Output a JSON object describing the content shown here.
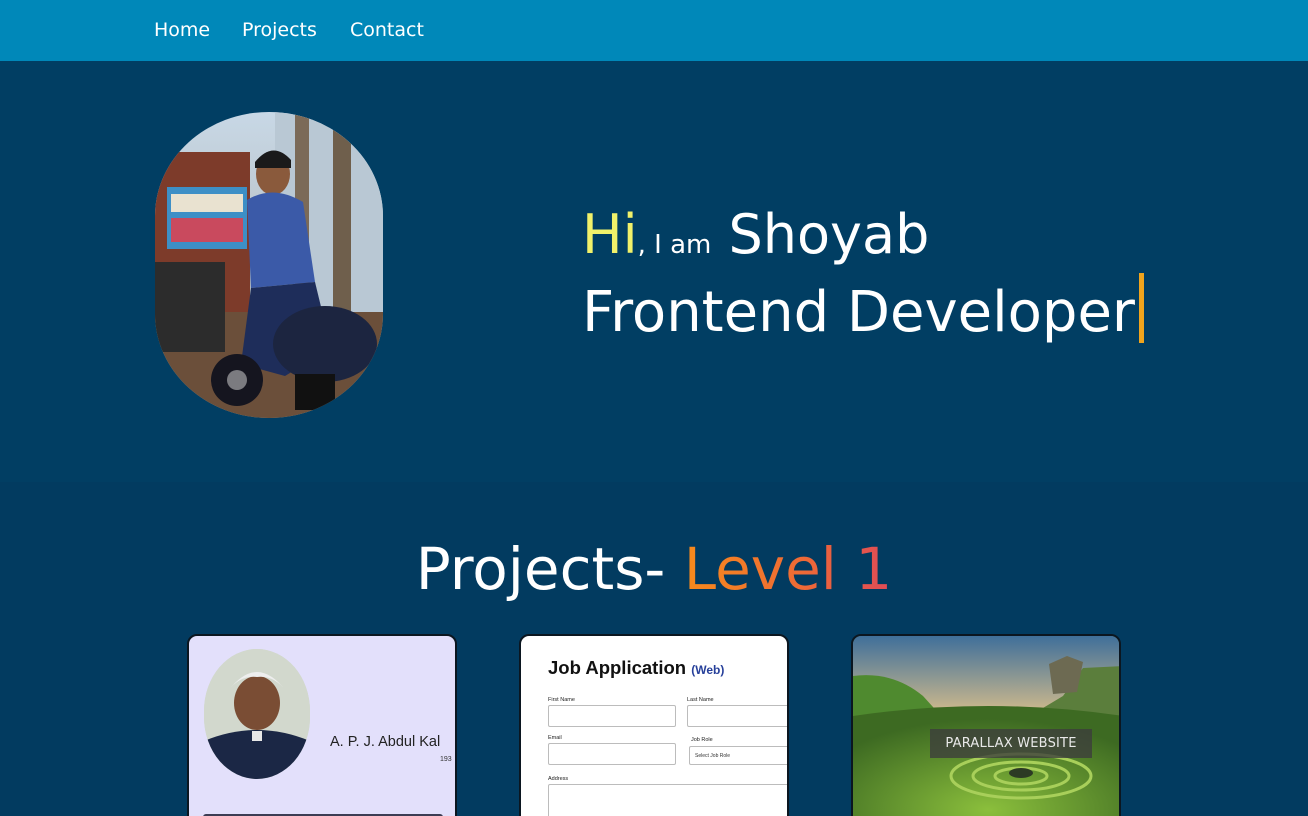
{
  "nav": {
    "items": [
      {
        "label": "Home"
      },
      {
        "label": "Projects"
      },
      {
        "label": "Contact"
      }
    ]
  },
  "hero": {
    "hi": "Hi",
    "iam": ", I am",
    "name": "Shoyab",
    "role": "Frontend Developer"
  },
  "projects": {
    "title_main": "Projects-",
    "title_level": "Level 1",
    "cards": [
      {
        "name": "A. P. J. Abdul Kal",
        "years": "193"
      },
      {
        "title": "Job Application",
        "tag": "(Web)",
        "fields": {
          "first_name": "First Name",
          "last_name": "Last Name",
          "email": "Email",
          "job_role": "Job Role",
          "job_role_value": "Select Job Role",
          "address": "Address"
        }
      },
      {
        "label": "PARALLAX WEBSITE"
      }
    ]
  },
  "colors": {
    "nav_bg": "#0088b9",
    "hero_bg": "#013e63",
    "hi_accent": "#f1f16a",
    "cursor_accent": "#f0a41d",
    "level_gradient_start": "#f78a1c",
    "level_gradient_end": "#e04b57"
  }
}
